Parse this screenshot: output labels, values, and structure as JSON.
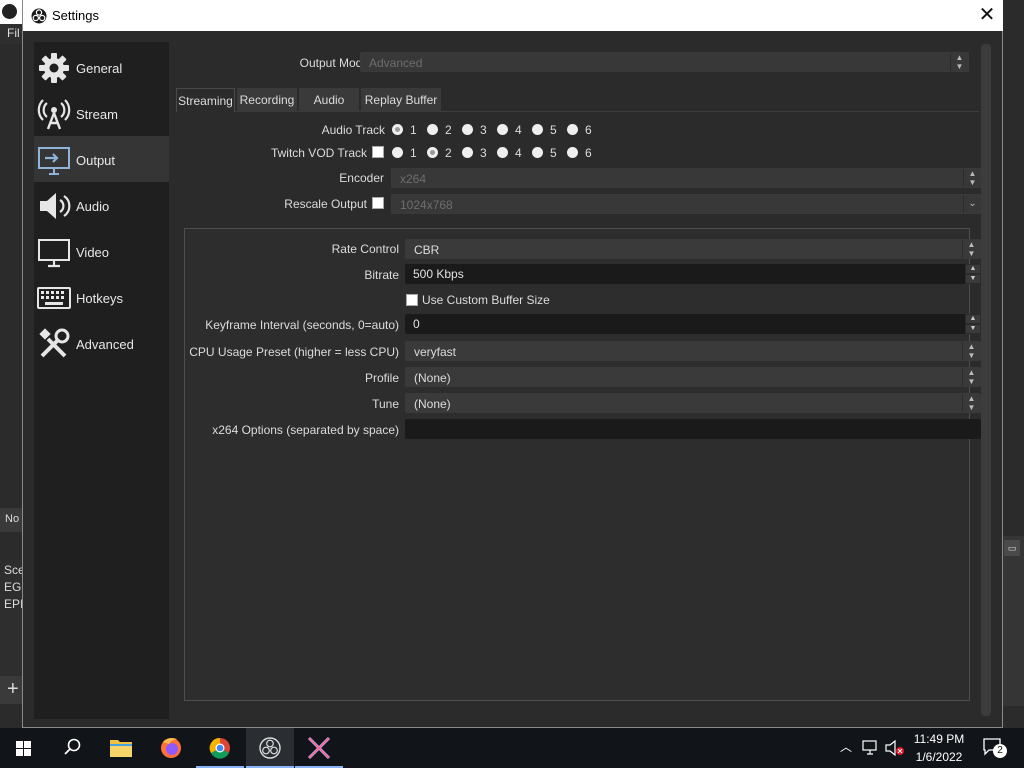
{
  "background": {
    "menu_partial": "Fil",
    "strip_partial": "No",
    "scenes_partial": [
      "Sce",
      "EGC",
      "EPI"
    ]
  },
  "dialog": {
    "title": "Settings",
    "close_glyph": "✕"
  },
  "sidebar": {
    "items": [
      {
        "label": "General",
        "icon": "gear-icon"
      },
      {
        "label": "Stream",
        "icon": "broadcast-antenna-icon"
      },
      {
        "label": "Output",
        "icon": "monitor-output-icon"
      },
      {
        "label": "Audio",
        "icon": "speaker-icon"
      },
      {
        "label": "Video",
        "icon": "monitor-icon"
      },
      {
        "label": "Hotkeys",
        "icon": "keyboard-icon"
      },
      {
        "label": "Advanced",
        "icon": "tools-icon"
      }
    ],
    "active": "Output"
  },
  "output": {
    "mode_label": "Output Mode",
    "mode_value": "Advanced",
    "tabs": [
      "Streaming",
      "Recording",
      "Audio",
      "Replay Buffer"
    ],
    "active_tab": "Streaming",
    "audio_track_label": "Audio Track",
    "twitch_vod_label": "Twitch VOD Track",
    "tracks": [
      "1",
      "2",
      "3",
      "4",
      "5",
      "6"
    ],
    "audio_track_selected": "1",
    "twitch_vod_selected": "2",
    "encoder_label": "Encoder",
    "encoder_value": "x264",
    "rescale_label": "Rescale Output",
    "rescale_value": "1024x768",
    "rate_control_label": "Rate Control",
    "rate_control_value": "CBR",
    "bitrate_label": "Bitrate",
    "bitrate_value": "500 Kbps",
    "custom_buffer_label": "Use Custom Buffer Size",
    "keyframe_label": "Keyframe Interval (seconds, 0=auto)",
    "keyframe_value": "0",
    "cpu_preset_label": "CPU Usage Preset (higher = less CPU)",
    "cpu_preset_value": "veryfast",
    "profile_label": "Profile",
    "profile_value": "(None)",
    "tune_label": "Tune",
    "tune_value": "(None)",
    "x264_options_label": "x264 Options (separated by space)",
    "x264_options_value": ""
  },
  "taskbar": {
    "time": "11:49 PM",
    "date": "1/6/2022",
    "notification_count": "2"
  }
}
